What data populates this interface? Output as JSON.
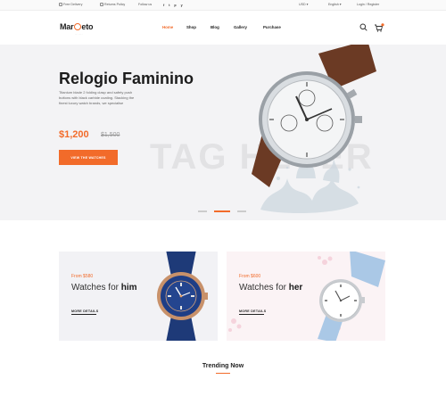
{
  "topbar": {
    "free_delivery": "Free Delivery",
    "returns_policy": "Returns Policy",
    "follow_us": "Follow us",
    "social": [
      "f",
      "t",
      "p",
      "y"
    ],
    "currency": "USD",
    "language": "English",
    "account": "Login / Register"
  },
  "header": {
    "logo_pre": "Mar",
    "logo_post": "eto",
    "nav": [
      "Home",
      "Shop",
      "Blog",
      "Gallery",
      "Purchase"
    ]
  },
  "hero": {
    "title": "Relogio Faminino",
    "description": "Titanium blade 2 folding clasp and safety push buttons with black carbide coating. Stacking the finest luxury watch brands, we specialise",
    "price": "$1,200",
    "old_price": "$1,500",
    "cta_label": "VIEW THE WATCHES",
    "bg_text": "TAG HEUER"
  },
  "cards": [
    {
      "from": "From $580",
      "title_pre": "Watches for ",
      "title_bold": "him",
      "more": "MORE DETAILS"
    },
    {
      "from": "From $600",
      "title_pre": "Watches for ",
      "title_bold": "her",
      "more": "MORE DETAILS"
    }
  ],
  "trending": {
    "title": "Trending Now"
  },
  "colors": {
    "accent": "#f26b2a",
    "hero_bg": "#f3f3f5",
    "card_left_bg": "#f2f2f5",
    "card_right_bg": "#fbf3f5"
  },
  "icons": [
    "truck-icon",
    "return-icon",
    "search-icon",
    "cart-icon",
    "facebook-icon",
    "twitter-icon",
    "pinterest-icon",
    "youtube-icon"
  ]
}
